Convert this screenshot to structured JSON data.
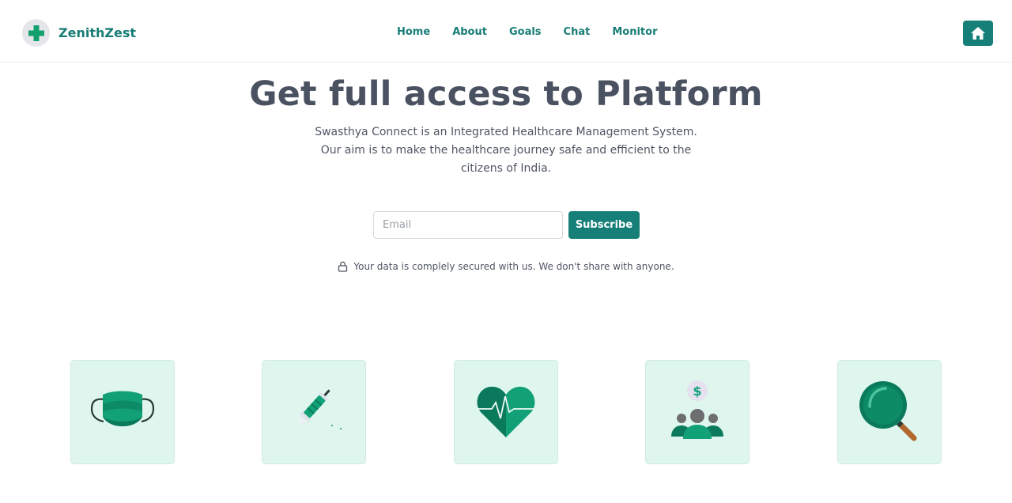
{
  "brand": {
    "name": "ZenithZest",
    "logo_icon": "medical-cross-icon"
  },
  "nav": {
    "links": [
      "Home",
      "About",
      "Goals",
      "Chat",
      "Monitor"
    ],
    "home_button_icon": "home-icon"
  },
  "hero": {
    "title": "Get full access to Platform",
    "description": "Swasthya Connect is an Integrated Healthcare Management System. Our aim is to make the healthcare journey safe and efficient to the citizens of India."
  },
  "subscribe": {
    "email_placeholder": "Email",
    "email_value": "",
    "button_label": "Subscribe"
  },
  "security_note": {
    "icon": "lock-icon",
    "text": "Your data is complely secured with us. We don't share with anyone."
  },
  "features": [
    {
      "icon": "face-mask-icon"
    },
    {
      "icon": "syringe-icon"
    },
    {
      "icon": "heart-pulse-icon"
    },
    {
      "icon": "community-funding-icon"
    },
    {
      "icon": "magnifying-glass-icon"
    }
  ],
  "colors": {
    "brand": "#177d76",
    "button": "#157f78",
    "card_bg": "#dff6ee",
    "text": "#4a5160",
    "icon_green": "#18a57a",
    "icon_dark_green": "#0b7a5c"
  }
}
